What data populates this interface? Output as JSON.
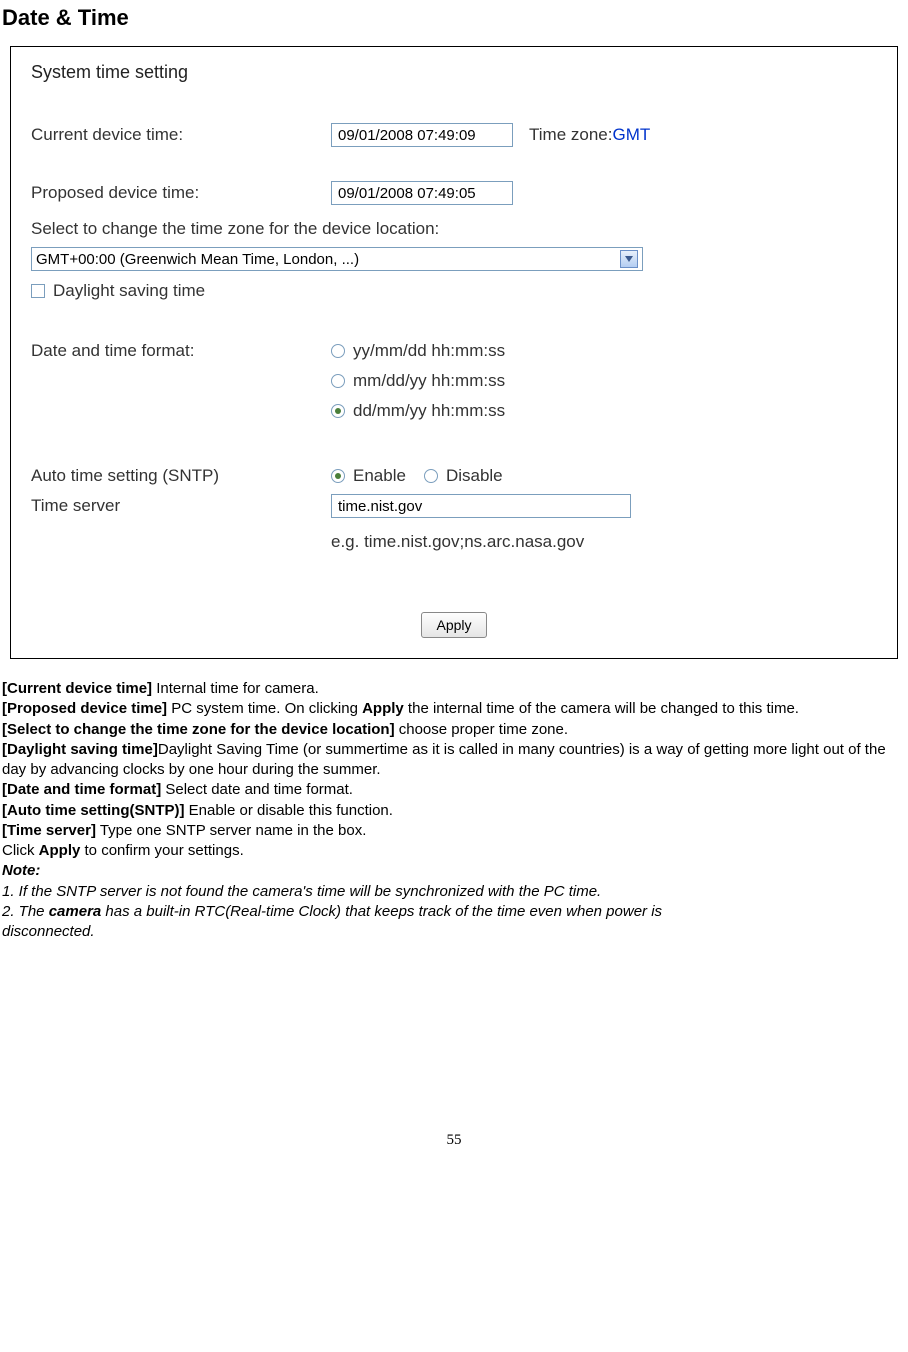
{
  "title": "Date & Time",
  "screenshot": {
    "heading": "System time setting",
    "current_label": "Current device time:",
    "current_value": "09/01/2008 07:49:09",
    "tz_label": "Time zone:",
    "tz_link": "GMT",
    "proposed_label": "Proposed device time:",
    "proposed_value": "09/01/2008 07:49:05",
    "select_tz_label": "Select to change the time zone for the device location:",
    "tz_selected": "GMT+00:00 (Greenwich Mean Time, London, ...)",
    "dst_label": "Daylight saving time",
    "format_label": "Date and time format:",
    "format_opt1": "yy/mm/dd hh:mm:ss",
    "format_opt2": "mm/dd/yy hh:mm:ss",
    "format_opt3": "dd/mm/yy hh:mm:ss",
    "sntp_label": "Auto time setting (SNTP)",
    "sntp_enable": "Enable",
    "sntp_disable": "Disable",
    "srv_label": "Time server",
    "srv_value": "time.nist.gov",
    "eg_text": "e.g. time.nist.gov;ns.arc.nasa.gov",
    "apply": "Apply"
  },
  "doc": {
    "l1a": "[Current device time]",
    "l1b": " Internal time for camera.",
    "l2a": "[Proposed device time]",
    "l2b": " PC system time. On clicking ",
    "l2c": "Apply",
    "l2d": " the internal time of the camera will be changed to this time.",
    "l3a": "[Select to change the time zone for the device location]",
    "l3b": " choose proper time zone.",
    "l4a": "[Daylight saving time]",
    "l4b": "Daylight Saving Time (or summertime as it is called in many countries) is a way of getting more light out of the day by advancing clocks by one hour during the summer.",
    "l5a": "[Date and time format]",
    "l5b": " Select date and time format.",
    "l6a": "[Auto time setting(SNTP)]",
    "l6b": " Enable or disable this function.",
    "l7a": "[Time server]",
    "l7b": " Type one SNTP server name in the box.",
    "l8a": "Click ",
    "l8b": "Apply",
    "l8c": " to confirm your settings.",
    "note": "Note:",
    "n1": "1. If the SNTP server is not found the camera's time will be synchronized with the PC time.",
    "n2a": "2. The ",
    "n2b": "camera",
    "n2c": " has a built-in RTC(Real-time Clock) that keeps track of the time even when power is",
    "n2d": "disconnected."
  },
  "page_number": "55"
}
